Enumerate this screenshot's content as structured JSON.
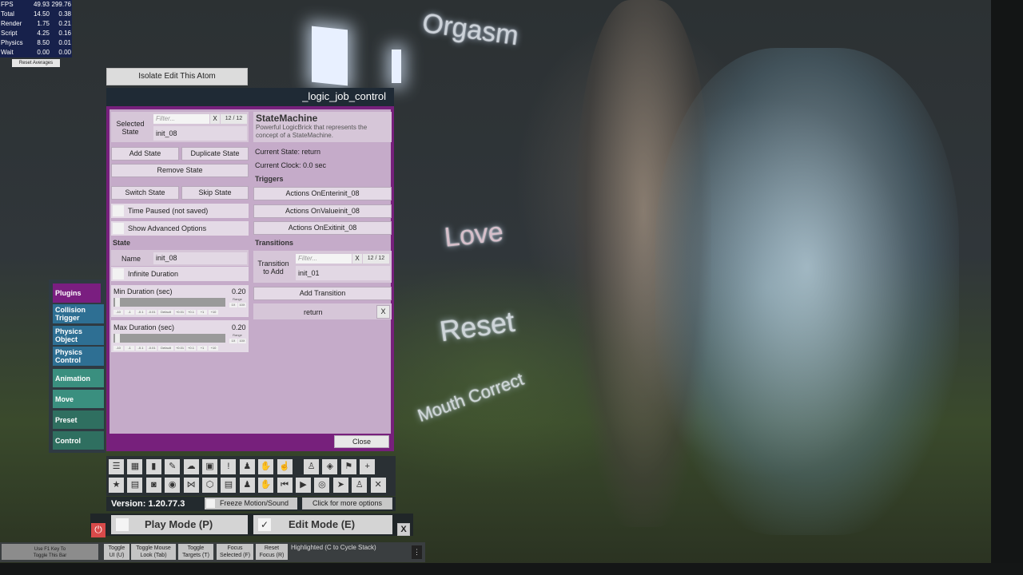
{
  "stats": {
    "rows": [
      {
        "label": "FPS",
        "a": "49.93",
        "b": "299.76"
      },
      {
        "label": "Total",
        "a": "14.50",
        "b": "0.38"
      },
      {
        "label": "Render",
        "a": "1.75",
        "b": "0.21"
      },
      {
        "label": "Script",
        "a": "4.25",
        "b": "0.16"
      },
      {
        "label": "Physics",
        "a": "8.50",
        "b": "0.01"
      },
      {
        "label": "Wait",
        "a": "0.00",
        "b": "0.00"
      }
    ],
    "reset_label": "Reset Averages"
  },
  "scene": {
    "signs": [
      "Orgasm",
      "Love",
      "Reset",
      "Mouth Correct"
    ]
  },
  "isolate_label": "Isolate Edit This Atom",
  "panel": {
    "title": "_logic_job_control",
    "selected_state_label": "Selected\nState",
    "filter_placeholder": "Filter...",
    "filter_clear": "X",
    "state_count": "12 / 12",
    "selected_state_value": "init_08",
    "add_state": "Add State",
    "duplicate_state": "Duplicate State",
    "remove_state": "Remove State",
    "switch_state": "Switch State",
    "skip_state": "Skip State",
    "time_paused": "Time Paused (not saved)",
    "show_advanced": "Show Advanced Options",
    "state_header": "State",
    "name_label": "Name",
    "name_value": "init_08",
    "infinite_duration": "Infinite Duration",
    "min_duration_label": "Min Duration (sec)",
    "min_duration_value": "0.20",
    "max_duration_label": "Max Duration (sec)",
    "max_duration_value": "0.20",
    "range_label": "Range",
    "slider_buttons": [
      "-10",
      "-1",
      "-0.1",
      "-0.01",
      "Default",
      "+0.01",
      "+0.1",
      "+1",
      "+10"
    ],
    "range_buttons": [
      "1X",
      "10X"
    ],
    "sm_title": "StateMachine",
    "sm_desc": "Powerful LogicBrick that represents the concept of a StateMachine.",
    "current_state": "Current State: return",
    "current_clock": "Current Clock: 0.0 sec",
    "triggers_header": "Triggers",
    "actions_enter": "Actions OnEnterinit_08",
    "actions_value": "Actions OnValueinit_08",
    "actions_exit": "Actions OnExitinit_08",
    "transitions_header": "Transitions",
    "transition_to_add_label": "Transition\nto Add",
    "transition_count": "12 / 12",
    "transition_value": "init_01",
    "add_transition": "Add Transition",
    "transition_item": "return",
    "remove_x": "X",
    "close": "Close"
  },
  "tabs": [
    {
      "label": "Plugins",
      "color": "#7a1e80"
    },
    {
      "label": "Collision Trigger",
      "color": "#2e6f93"
    },
    {
      "label": "Physics Object",
      "color": "#2e6f93"
    },
    {
      "label": "Physics Control",
      "color": "#2e6f93"
    },
    {
      "label": "Animation",
      "color": "#3a8f7f"
    },
    {
      "label": "Move",
      "color": "#3a8f7f"
    },
    {
      "label": "Preset",
      "color": "#2f6f60"
    },
    {
      "label": "Control",
      "color": "#2f6f60"
    }
  ],
  "toolbar": {
    "row1": [
      "menu-icon",
      "scene-icon",
      "folder-icon",
      "delete-icon",
      "cloud-icon",
      "box-icon",
      "info-icon",
      "person-icon",
      "hand-icon",
      "hand-pointer-icon",
      "user-icon",
      "unity-icon",
      "flag-icon",
      "plus-icon"
    ],
    "row2": [
      "star-icon",
      "edit-scene-icon",
      "screenshot-icon",
      "camera-icon",
      "nodes-icon",
      "package-icon",
      "document-icon",
      "person-settings-icon",
      "hand-settings-icon",
      "skip-back-icon",
      "play-icon",
      "target-icon",
      "cursor-icon",
      "users-icon",
      "tools-icon"
    ],
    "glyphs1": [
      "☰",
      "▦",
      "▮",
      "✎",
      "☁",
      "▣",
      "!",
      "♟",
      "✋",
      "☝",
      "♙",
      "◈",
      "⚑",
      "+"
    ],
    "glyphs2": [
      "★",
      "▤",
      "◙",
      "◉",
      "⋈",
      "⬡",
      "▤",
      "♟",
      "✋",
      "⏮",
      "▶",
      "◎",
      "➤",
      "♙",
      "✕"
    ]
  },
  "version": "Version: 1.20.77.3",
  "freeze_motion": "Freeze Motion/Sound",
  "more_options": "Click for more options",
  "play_mode": "Play Mode (P)",
  "edit_mode": "Edit Mode (E)",
  "edit_check": "✓",
  "close_x": "X",
  "bottom": {
    "f1_hint": "Use F1 Key To\nToggle This Bar",
    "toggle_ui": "Toggle\nUI (U)",
    "toggle_mouse": "Toggle Mouse\nLook (Tab)",
    "toggle_targets": "Toggle\nTargets (T)",
    "focus_selected": "Focus\nSelected (F)",
    "reset_focus": "Reset\nFocus (R)",
    "highlighted": "Highlighted (C to Cycle Stack)"
  }
}
